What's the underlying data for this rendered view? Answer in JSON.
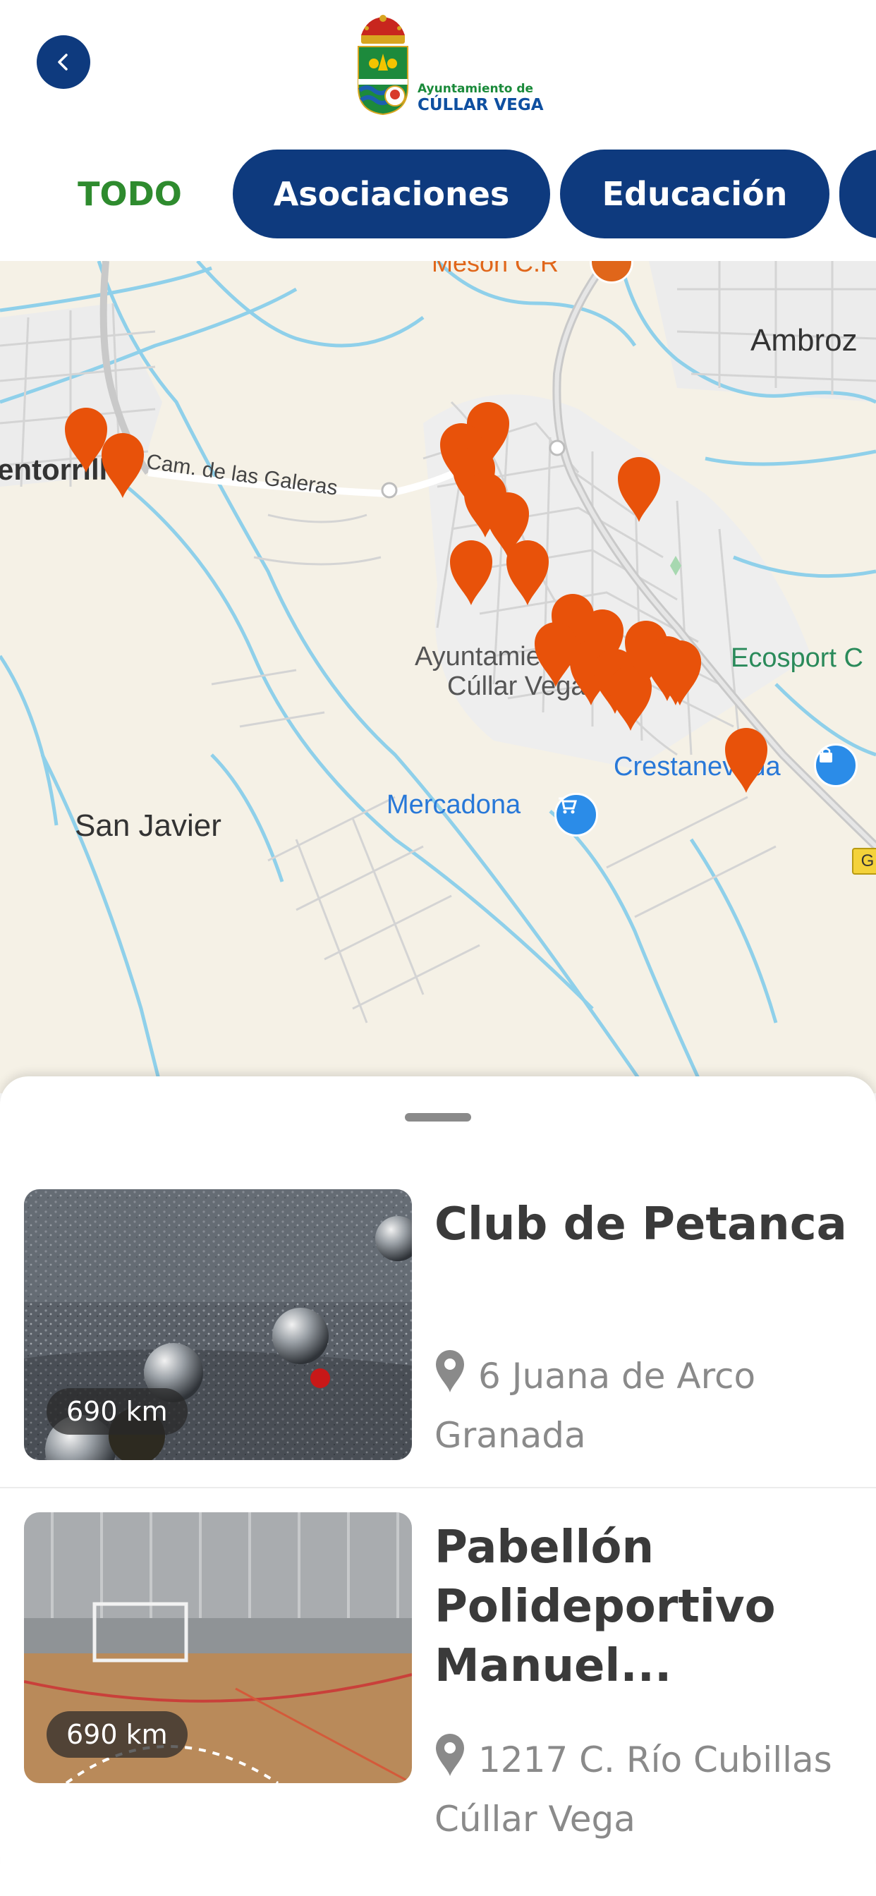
{
  "header": {
    "back_icon": "chevron-left-icon",
    "logo_line1": "Ayuntamiento de",
    "logo_line2": "CÚLLAR VEGA",
    "colors": {
      "primary": "#0e3a7e",
      "accent_green": "#2e8b2e",
      "pin": "#e8520a"
    }
  },
  "tabs": [
    {
      "label": "TODO",
      "active": true
    },
    {
      "label": "Asociaciones",
      "active": false
    },
    {
      "label": "Educación",
      "active": false
    }
  ],
  "map": {
    "labels": {
      "torrillo": "entorrillo",
      "galeras": "Cam. de las Galeras",
      "ambroz": "Ambroz",
      "ayuntamiento_1": "Ayuntamiento",
      "ayuntamiento_2": "Cúllar Vega",
      "ecosport": "Ecosport C",
      "crestanevada": "Crestanevada",
      "mercadona": "Mercadona",
      "san_javier": "San Javier",
      "meson": "Mesón C.R",
      "road_shield": "G"
    },
    "marker_count": 22
  },
  "places": [
    {
      "title": "Club de Petanca",
      "distance": "690 km",
      "address_line1": "6 Juana de Arco",
      "address_line2": "Granada"
    },
    {
      "title": "Pabellón Polideportivo Manuel...",
      "distance": "690 km",
      "address_line1": "1217 C. Río Cubillas",
      "address_line2": "Cúllar Vega"
    }
  ]
}
